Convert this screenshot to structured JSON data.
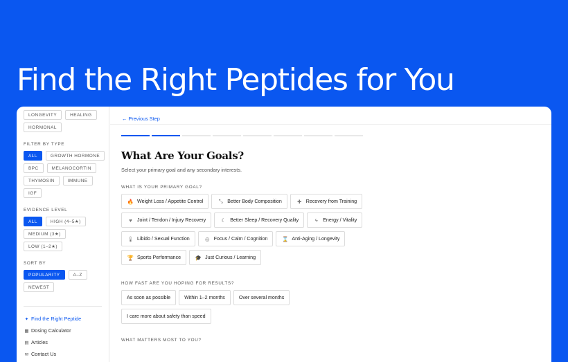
{
  "hero": {
    "title": "Find the Right Peptides for You"
  },
  "sidebar": {
    "top_tags": [
      "LONGEVITY",
      "HEALING",
      "HORMONAL"
    ],
    "filter_type": {
      "label": "FILTER BY TYPE",
      "options": [
        "ALL",
        "GROWTH HORMONE",
        "BPC",
        "MELANOCORTIN",
        "THYMOSIN",
        "IMMUNE",
        "IGF"
      ],
      "selected": "ALL"
    },
    "evidence": {
      "label": "EVIDENCE LEVEL",
      "options": [
        "ALL",
        "HIGH (4–5★)",
        "MEDIUM (3★)",
        "LOW (1–2★)"
      ],
      "selected": "ALL"
    },
    "sort": {
      "label": "SORT BY",
      "options": [
        "POPULARITY",
        "A–Z",
        "NEWEST"
      ],
      "selected": "POPULARITY"
    },
    "nav": [
      {
        "label": "Find the Right Peptide",
        "icon": "sparkle-icon",
        "glyph": "✦",
        "active": true
      },
      {
        "label": "Dosing Calculator",
        "icon": "calculator-icon",
        "glyph": "▦",
        "active": false
      },
      {
        "label": "Articles",
        "icon": "article-icon",
        "glyph": "▤",
        "active": false
      },
      {
        "label": "Contact Us",
        "icon": "mail-icon",
        "glyph": "✉",
        "active": false
      }
    ]
  },
  "main": {
    "prev_step": "← Previous Step",
    "progress": {
      "total_steps": 8,
      "completed_steps": 2
    },
    "title": "What Are Your Goals?",
    "subtitle": "Select your primary goal and any secondary interests.",
    "primary_goal": {
      "label": "WHAT IS YOUR PRIMARY GOAL?",
      "options": [
        {
          "label": "Weight Loss / Appetite Control",
          "icon": "flame-icon",
          "glyph": "🔥"
        },
        {
          "label": "Better Body Composition",
          "icon": "resize-icon",
          "glyph": "⤡"
        },
        {
          "label": "Recovery from Training",
          "icon": "bandage-icon",
          "glyph": "✚"
        },
        {
          "label": "Joint / Tendon / Injury Recovery",
          "icon": "heart-icon",
          "glyph": "♥"
        },
        {
          "label": "Better Sleep / Recovery Quality",
          "icon": "moon-icon",
          "glyph": "☾"
        },
        {
          "label": "Energy / Vitality",
          "icon": "bolt-icon",
          "glyph": "ϟ"
        },
        {
          "label": "Libido / Sexual Function",
          "icon": "thermometer-icon",
          "glyph": "🌡"
        },
        {
          "label": "Focus / Calm / Cognition",
          "icon": "brain-icon",
          "glyph": "◎"
        },
        {
          "label": "Anti-Aging / Longevity",
          "icon": "hourglass-icon",
          "glyph": "⌛"
        },
        {
          "label": "Sports Performance",
          "icon": "trophy-icon",
          "glyph": "🏆"
        },
        {
          "label": "Just Curious / Learning",
          "icon": "graduation-cap-icon",
          "glyph": "🎓"
        }
      ]
    },
    "speed": {
      "label": "HOW FAST ARE YOU HOPING FOR RESULTS?",
      "options": [
        "As soon as possible",
        "Within 1–2 months",
        "Over several months",
        "I care more about safety than speed"
      ]
    },
    "matters": {
      "label": "WHAT MATTERS MOST TO YOU?"
    }
  }
}
